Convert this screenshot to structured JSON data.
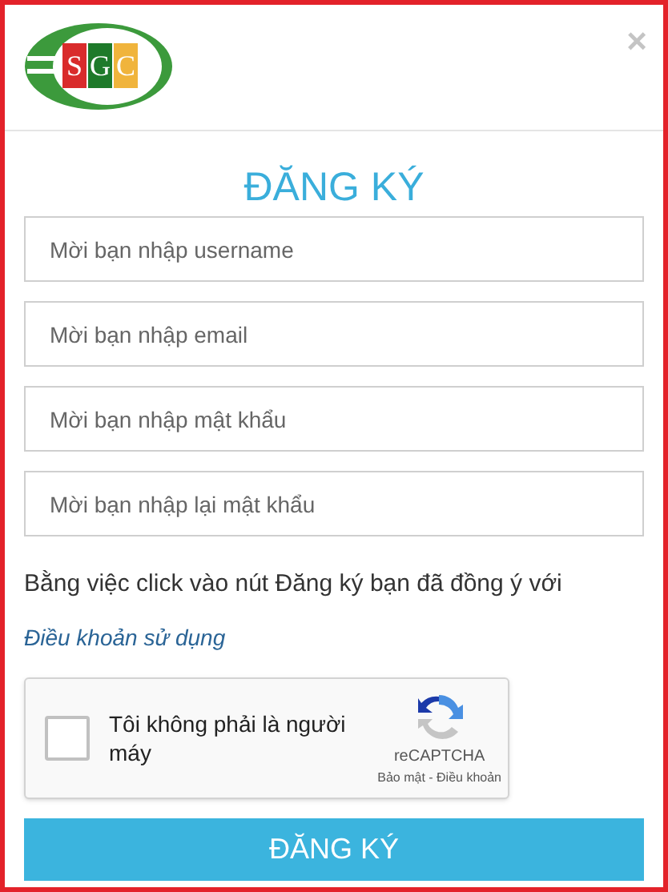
{
  "logo": {
    "letters": [
      "S",
      "G",
      "C"
    ]
  },
  "close": "×",
  "title": "ĐĂNG KÝ",
  "fields": [
    {
      "placeholder": "Mời bạn nhập username"
    },
    {
      "placeholder": "Mời bạn nhập email"
    },
    {
      "placeholder": "Mời bạn nhập mật khẩu"
    },
    {
      "placeholder": "Mời bạn nhập lại mật khẩu"
    }
  ],
  "agreement": "Bằng việc click vào nút Đăng ký bạn đã đồng ý với",
  "terms_link": "Điều khoản sử dụng",
  "captcha": {
    "checked": false,
    "label": "Tôi không phải là người máy",
    "brand": "reCAPTCHA",
    "links": "Bảo mật - Điều khoản"
  },
  "submit": "ĐĂNG KÝ"
}
